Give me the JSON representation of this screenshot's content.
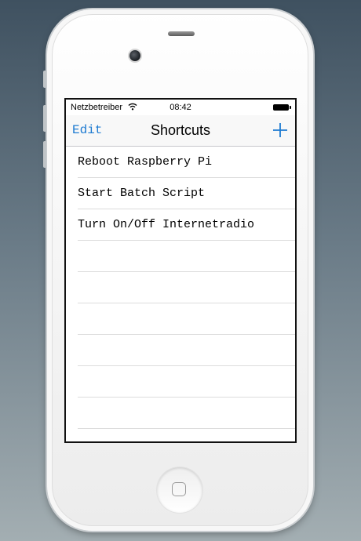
{
  "status_bar": {
    "carrier": "Netzbetreiber",
    "time": "08:42"
  },
  "nav": {
    "edit_label": "Edit",
    "title": "Shortcuts",
    "add_icon": "plus-icon"
  },
  "shortcuts": [
    "Reboot Raspberry Pi",
    "Start Batch Script",
    "Turn On/Off Internetradio",
    "",
    "",
    "",
    "",
    "",
    "",
    ""
  ],
  "colors": {
    "accent": "#1e7bd1",
    "background_top": "#3f5160",
    "background_bottom": "#a3aeb2",
    "phone_body": "#ffffff"
  }
}
